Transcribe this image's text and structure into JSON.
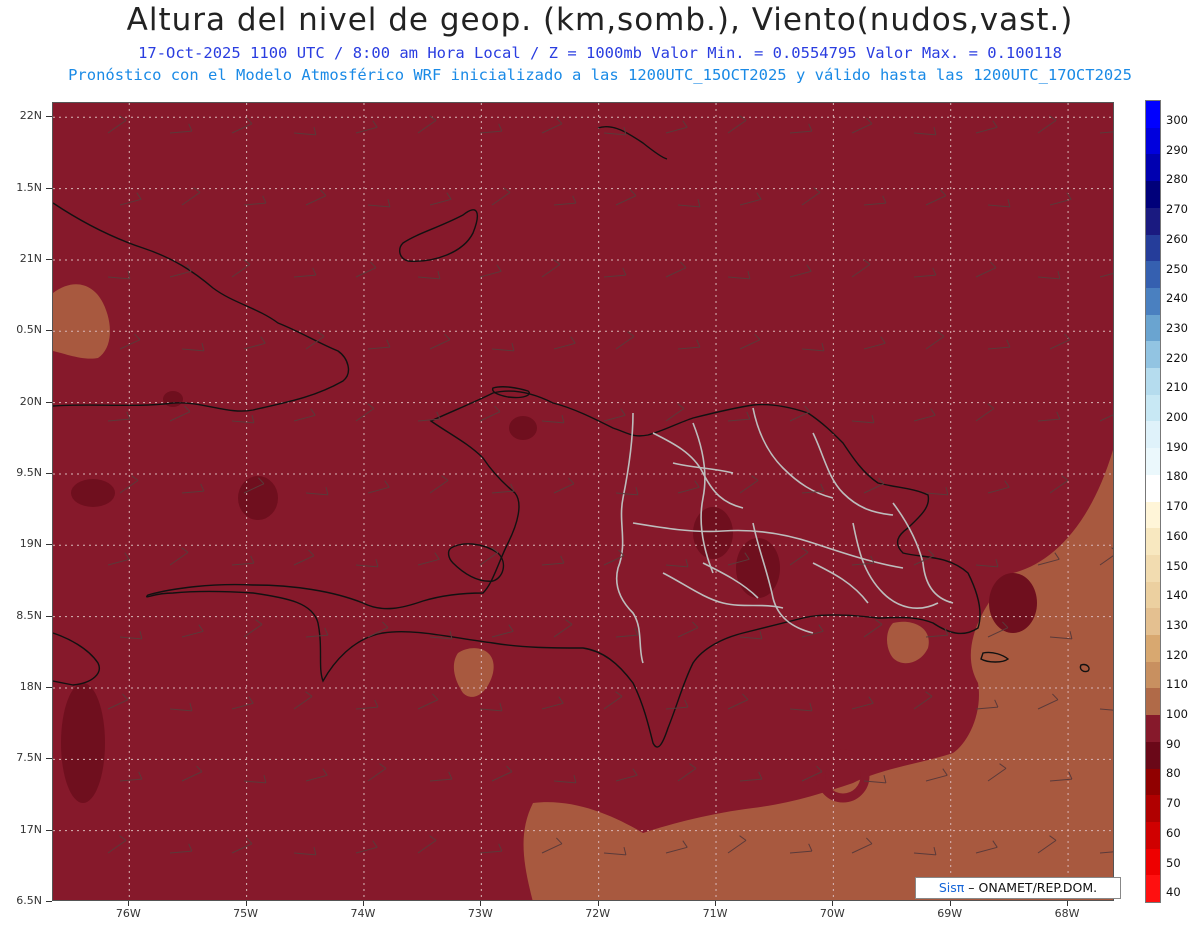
{
  "header": {
    "title": "Altura del nivel de geop. (km,somb.), Viento(nudos,vast.)",
    "subtitle1": "17-Oct-2025  1100 UTC / 8:00 am Hora Local / Z = 1000mb  Valor Min. = 0.0554795  Valor Max. = 0.100118",
    "subtitle2": "Pronóstico con el Modelo Atmosférico WRF inicializado a las 1200UTC_15OCT2025 y válido hasta las  1200UTC_17OCT2025"
  },
  "map": {
    "lat_labels": [
      "22N",
      "1.5N",
      "21N",
      "0.5N",
      "20N",
      "9.5N",
      "19N",
      "8.5N",
      "18N",
      "7.5N",
      "17N",
      "6.5N"
    ],
    "lon_labels": [
      "76W",
      "75W",
      "74W",
      "73W",
      "72W",
      "71W",
      "70W",
      "69W",
      "68W"
    ],
    "lat_range": [
      16.5,
      22.1
    ],
    "lon_range": [
      -76.65,
      -67.6
    ],
    "base_color": "#86192b",
    "light_color": "#a8593f",
    "dark_color": "#6f0f1e",
    "coast_color": "#111111",
    "border_color": "#bdbdbd",
    "grid": true
  },
  "colorbar": {
    "labels": [
      "300",
      "290",
      "280",
      "270",
      "260",
      "250",
      "240",
      "230",
      "220",
      "210",
      "200",
      "190",
      "180",
      "170",
      "160",
      "150",
      "140",
      "130",
      "120",
      "110",
      "100",
      "90",
      "80",
      "70",
      "60",
      "50",
      "40"
    ],
    "colors": [
      "#0000ff",
      "#0000dd",
      "#0000b0",
      "#00007a",
      "#1a1a80",
      "#253d9a",
      "#3560b0",
      "#4a80c0",
      "#6aa4d0",
      "#92c4e2",
      "#b5dcee",
      "#c8e8f4",
      "#dff2fa",
      "#ebf8fc",
      "#ffffff",
      "#fff5d8",
      "#f8e8c0",
      "#f2dcb0",
      "#ecd0a0",
      "#e4c090",
      "#d8a870",
      "#c89060",
      "#b06a48",
      "#86192b",
      "#6a0818",
      "#900000",
      "#b00000",
      "#d00000",
      "#ee0000",
      "#ff1010"
    ]
  },
  "logo": {
    "brand": "Sisπ",
    "text": "– ONAMET/REP.DOM."
  }
}
